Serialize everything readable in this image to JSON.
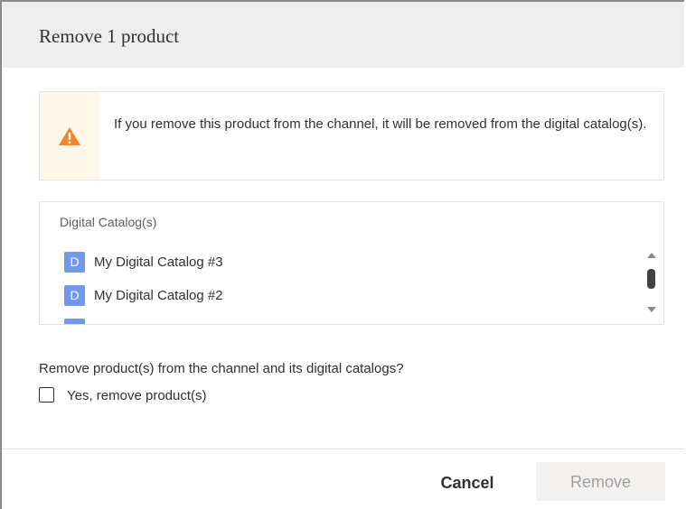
{
  "dialog": {
    "title": "Remove 1 product"
  },
  "warning": {
    "icon": "warning-triangle",
    "icon_color": "#f2862c",
    "message": "If you remove this product from the channel, it will be removed from the digital catalog(s)."
  },
  "catalogs": {
    "label": "Digital Catalog(s)",
    "items": [
      {
        "badge": "D",
        "name": "My Digital Catalog #3"
      },
      {
        "badge": "D",
        "name": "My Digital Catalog #2"
      },
      {
        "badge": "D",
        "name": ""
      }
    ],
    "badge_color": "#6f98ee"
  },
  "confirm": {
    "question": "Remove product(s) from the channel and its digital catalogs?",
    "checkbox_label": "Yes, remove product(s)",
    "checked": false
  },
  "footer": {
    "cancel_label": "Cancel",
    "remove_label": "Remove",
    "remove_enabled": false
  }
}
